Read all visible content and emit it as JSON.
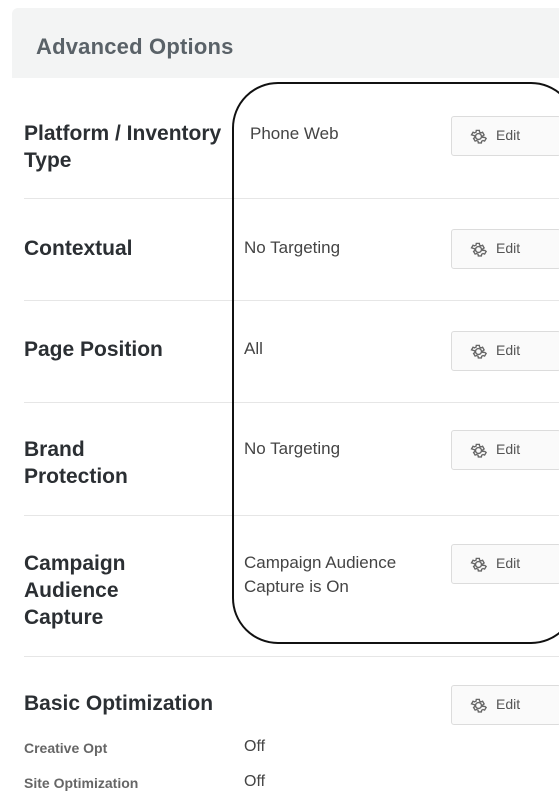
{
  "header": {
    "title": "Advanced Options"
  },
  "edit_label": "Edit",
  "rows": [
    {
      "label": "Platform / Inventory Type",
      "value": "Phone Web"
    },
    {
      "label": "Contextual",
      "value": "No Targeting"
    },
    {
      "label": "Page Position",
      "value": "All"
    },
    {
      "label": "Brand Protection",
      "value": "No Targeting"
    },
    {
      "label": "Campaign Audience Capture",
      "value": "Campaign Audience Capture is On"
    }
  ],
  "basic_optimization": {
    "title": "Basic Optimization",
    "creative_opt": {
      "label": "Creative Opt",
      "value": "Off"
    },
    "site_optimization": {
      "label": "Site Optimization",
      "value": "Off"
    }
  }
}
